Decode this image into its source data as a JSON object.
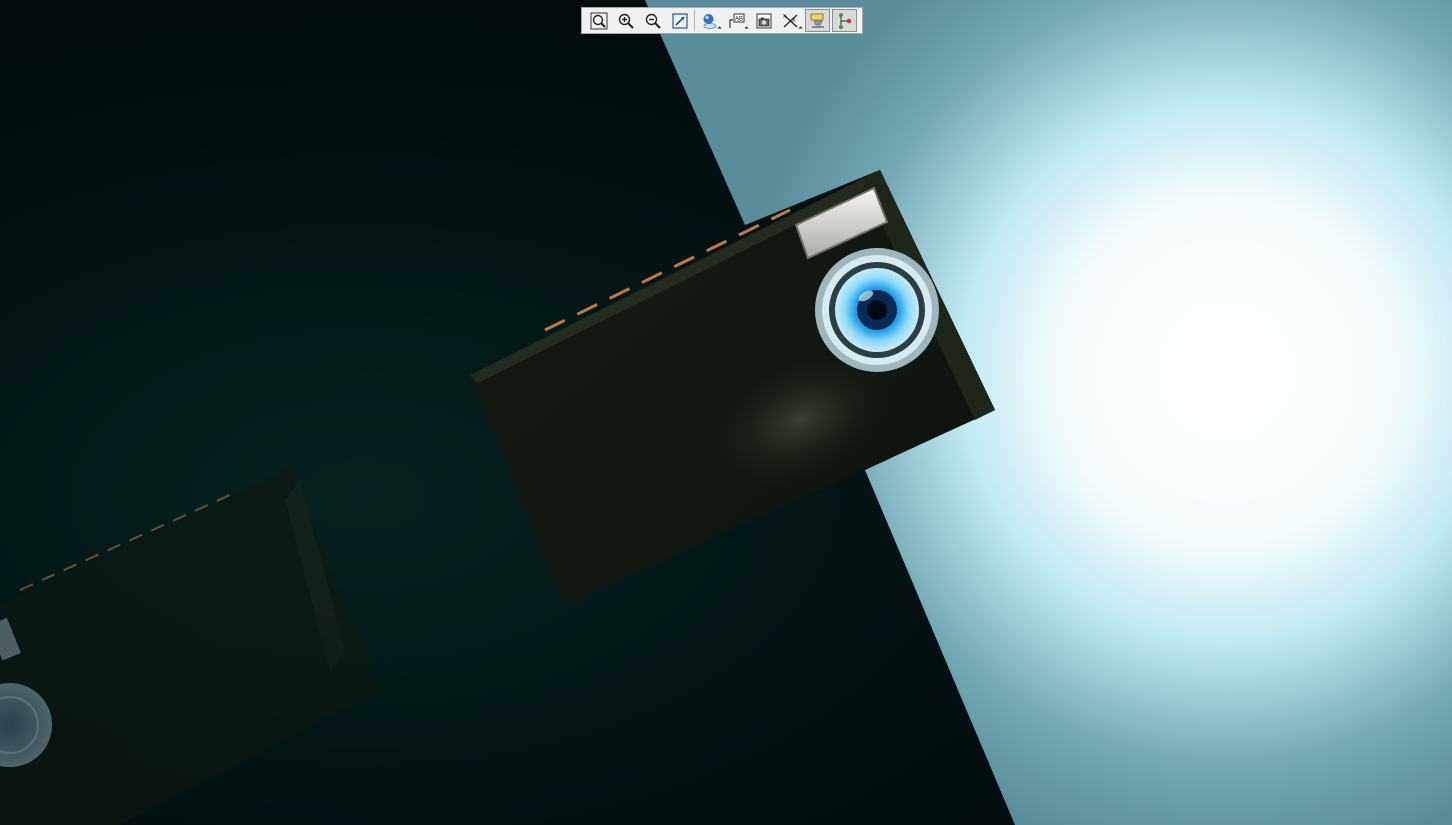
{
  "viewer": {
    "background_dark": "#041416",
    "background_glow": "#ffffff",
    "background_teal": "#5f97a5",
    "camera_body_color": "#141a12",
    "camera_accent_color": "#c07a3a",
    "lens_blue": "#2aa8e8"
  },
  "toolbar": {
    "buttons": [
      {
        "name": "zoom-fit-button",
        "icon": "zoom-fit-icon",
        "active": false,
        "dropdown": false
      },
      {
        "name": "zoom-in-button",
        "icon": "zoom-in-icon",
        "active": false,
        "dropdown": false
      },
      {
        "name": "zoom-out-button",
        "icon": "zoom-out-icon",
        "active": false,
        "dropdown": false
      },
      {
        "name": "zoom-window-button",
        "icon": "zoom-window-icon",
        "active": false,
        "dropdown": false
      },
      {
        "name": "render-style-button",
        "icon": "render-style-icon",
        "active": false,
        "dropdown": true
      },
      {
        "name": "text-annotation-button",
        "icon": "text-annotation-icon",
        "active": false,
        "dropdown": true
      },
      {
        "name": "snapshot-button",
        "icon": "camera-snapshot-icon",
        "active": false,
        "dropdown": false
      },
      {
        "name": "measure-button",
        "icon": "measure-icon",
        "active": false,
        "dropdown": true
      },
      {
        "name": "section-plane-button",
        "icon": "section-plane-icon",
        "active": true,
        "dropdown": false
      },
      {
        "name": "explode-button",
        "icon": "explode-tree-icon",
        "active": true,
        "dropdown": false
      }
    ]
  }
}
